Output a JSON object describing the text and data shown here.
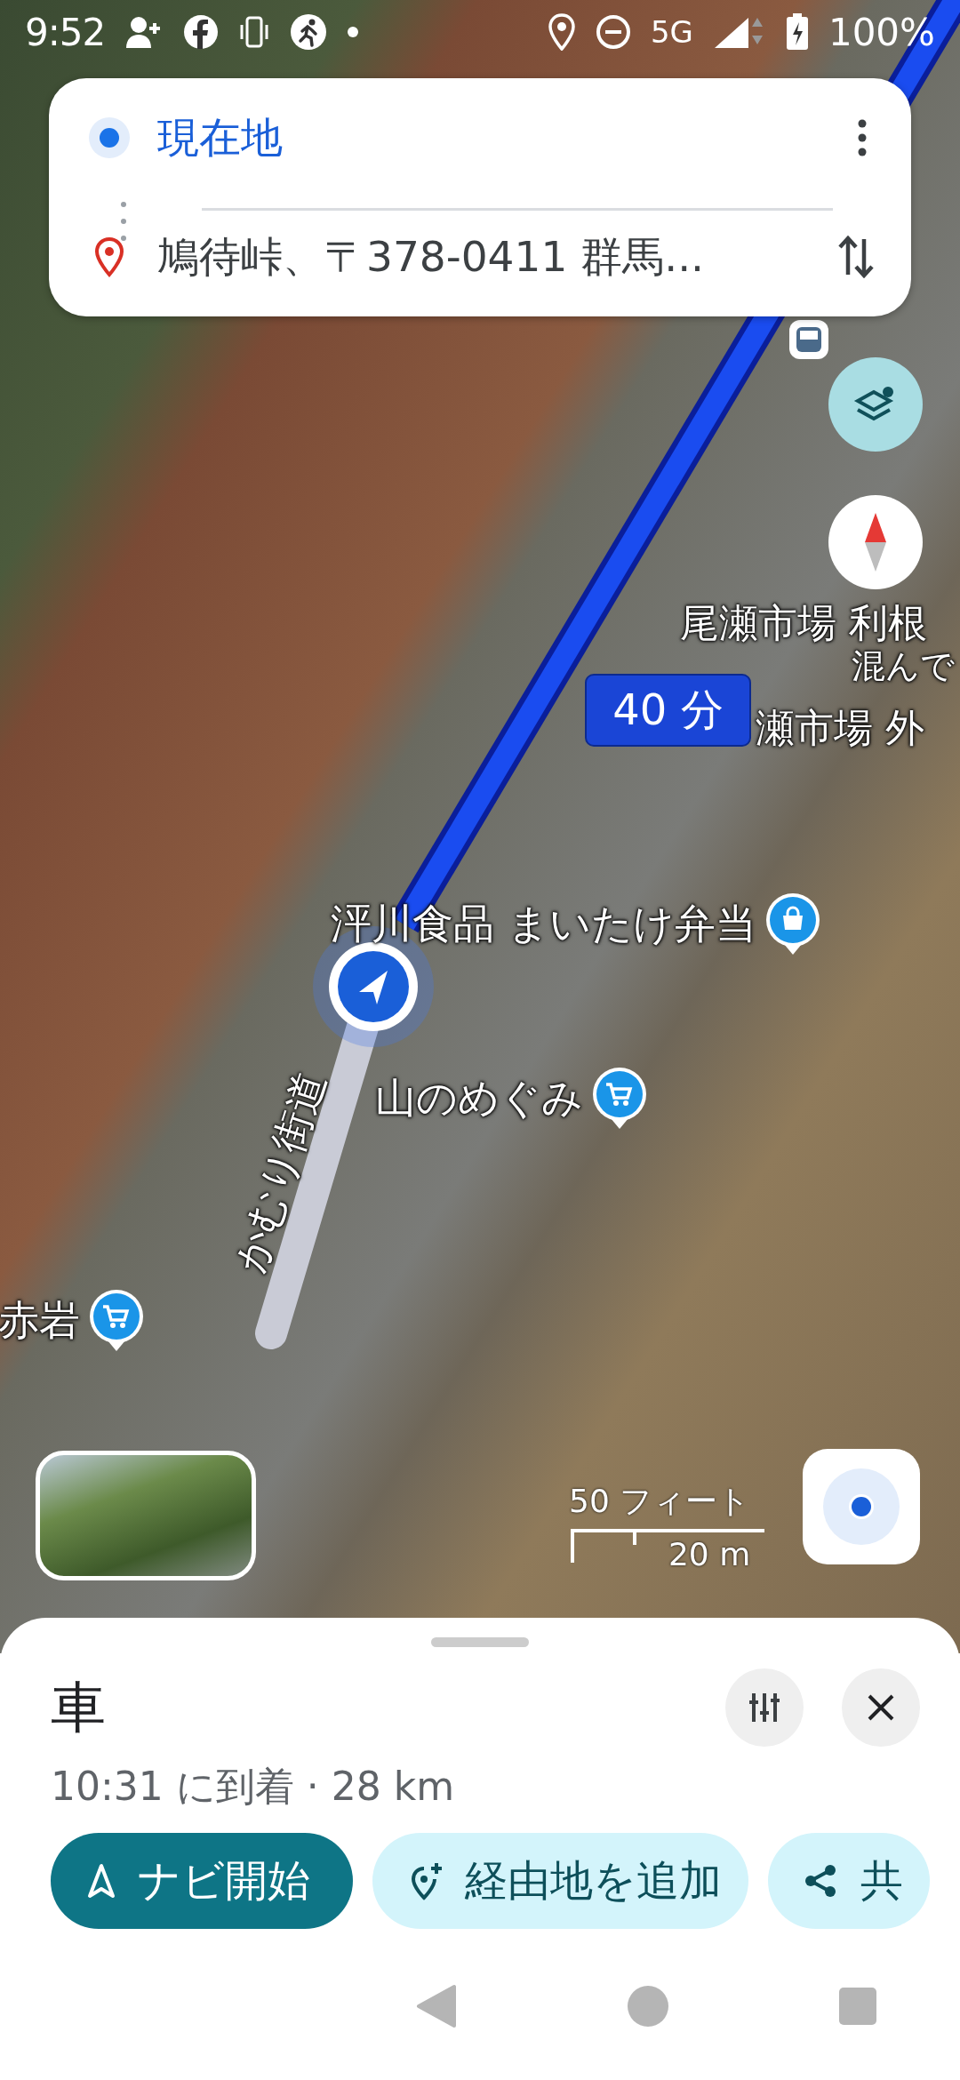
{
  "status_bar": {
    "time": "9:52",
    "network": "5G",
    "battery": "100%"
  },
  "directions": {
    "origin": "現在地",
    "destination": "鳩待峠、〒378-0411 群馬..."
  },
  "map": {
    "eta_badge": "40 分",
    "labels": [
      {
        "text": "尾瀬市場 利根",
        "kind": "place"
      },
      {
        "text": "混んで",
        "kind": "note"
      },
      {
        "text": "瀬市場 外",
        "kind": "place"
      },
      {
        "text": "泙川食品 まいたけ弁当",
        "kind": "store"
      },
      {
        "text": "山のめぐみ",
        "kind": "market"
      },
      {
        "text": "赤岩",
        "kind": "market"
      },
      {
        "text": "かむり街道",
        "kind": "road"
      }
    ],
    "scale": {
      "imperial": "50 フィート",
      "metric": "20 m"
    }
  },
  "sheet": {
    "mode": "車",
    "arrival": "10:31 に到着 · 28 km",
    "actions": [
      {
        "label": "ナビ開始",
        "kind": "start"
      },
      {
        "label": "経由地を追加",
        "kind": "waypoint"
      },
      {
        "label": "共",
        "kind": "share"
      }
    ]
  }
}
